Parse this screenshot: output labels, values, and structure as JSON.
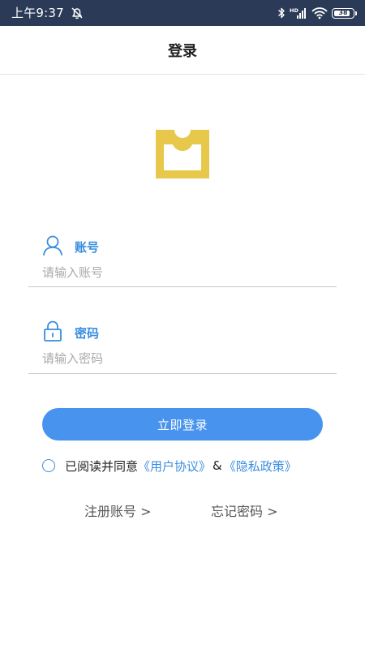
{
  "status_bar": {
    "time": "上午9:37",
    "battery_level": "38",
    "background_color": "#2b3a57",
    "icons": [
      "alarm-off-icon",
      "bluetooth-icon",
      "hd-signal-icon",
      "wifi-icon",
      "battery-icon"
    ]
  },
  "header": {
    "title": "登录"
  },
  "logo": {
    "icon": "app-logo-icon",
    "color": "#e8c84a"
  },
  "account_field": {
    "icon": "user-icon",
    "label": "账号",
    "placeholder": "请输入账号",
    "value": ""
  },
  "password_field": {
    "icon": "lock-icon",
    "label": "密码",
    "placeholder": "请输入密码",
    "value": ""
  },
  "login_button": {
    "label": "立即登录",
    "color": "#4893ee"
  },
  "agreement": {
    "checked": false,
    "prefix": "已阅读并同意",
    "user_agreement": "《用户协议》",
    "ampersand": "&",
    "privacy_policy": "《隐私政策》",
    "link_color": "#3a8de0"
  },
  "footer_links": {
    "register": "注册账号 >",
    "forgot_password": "忘记密码 >"
  }
}
